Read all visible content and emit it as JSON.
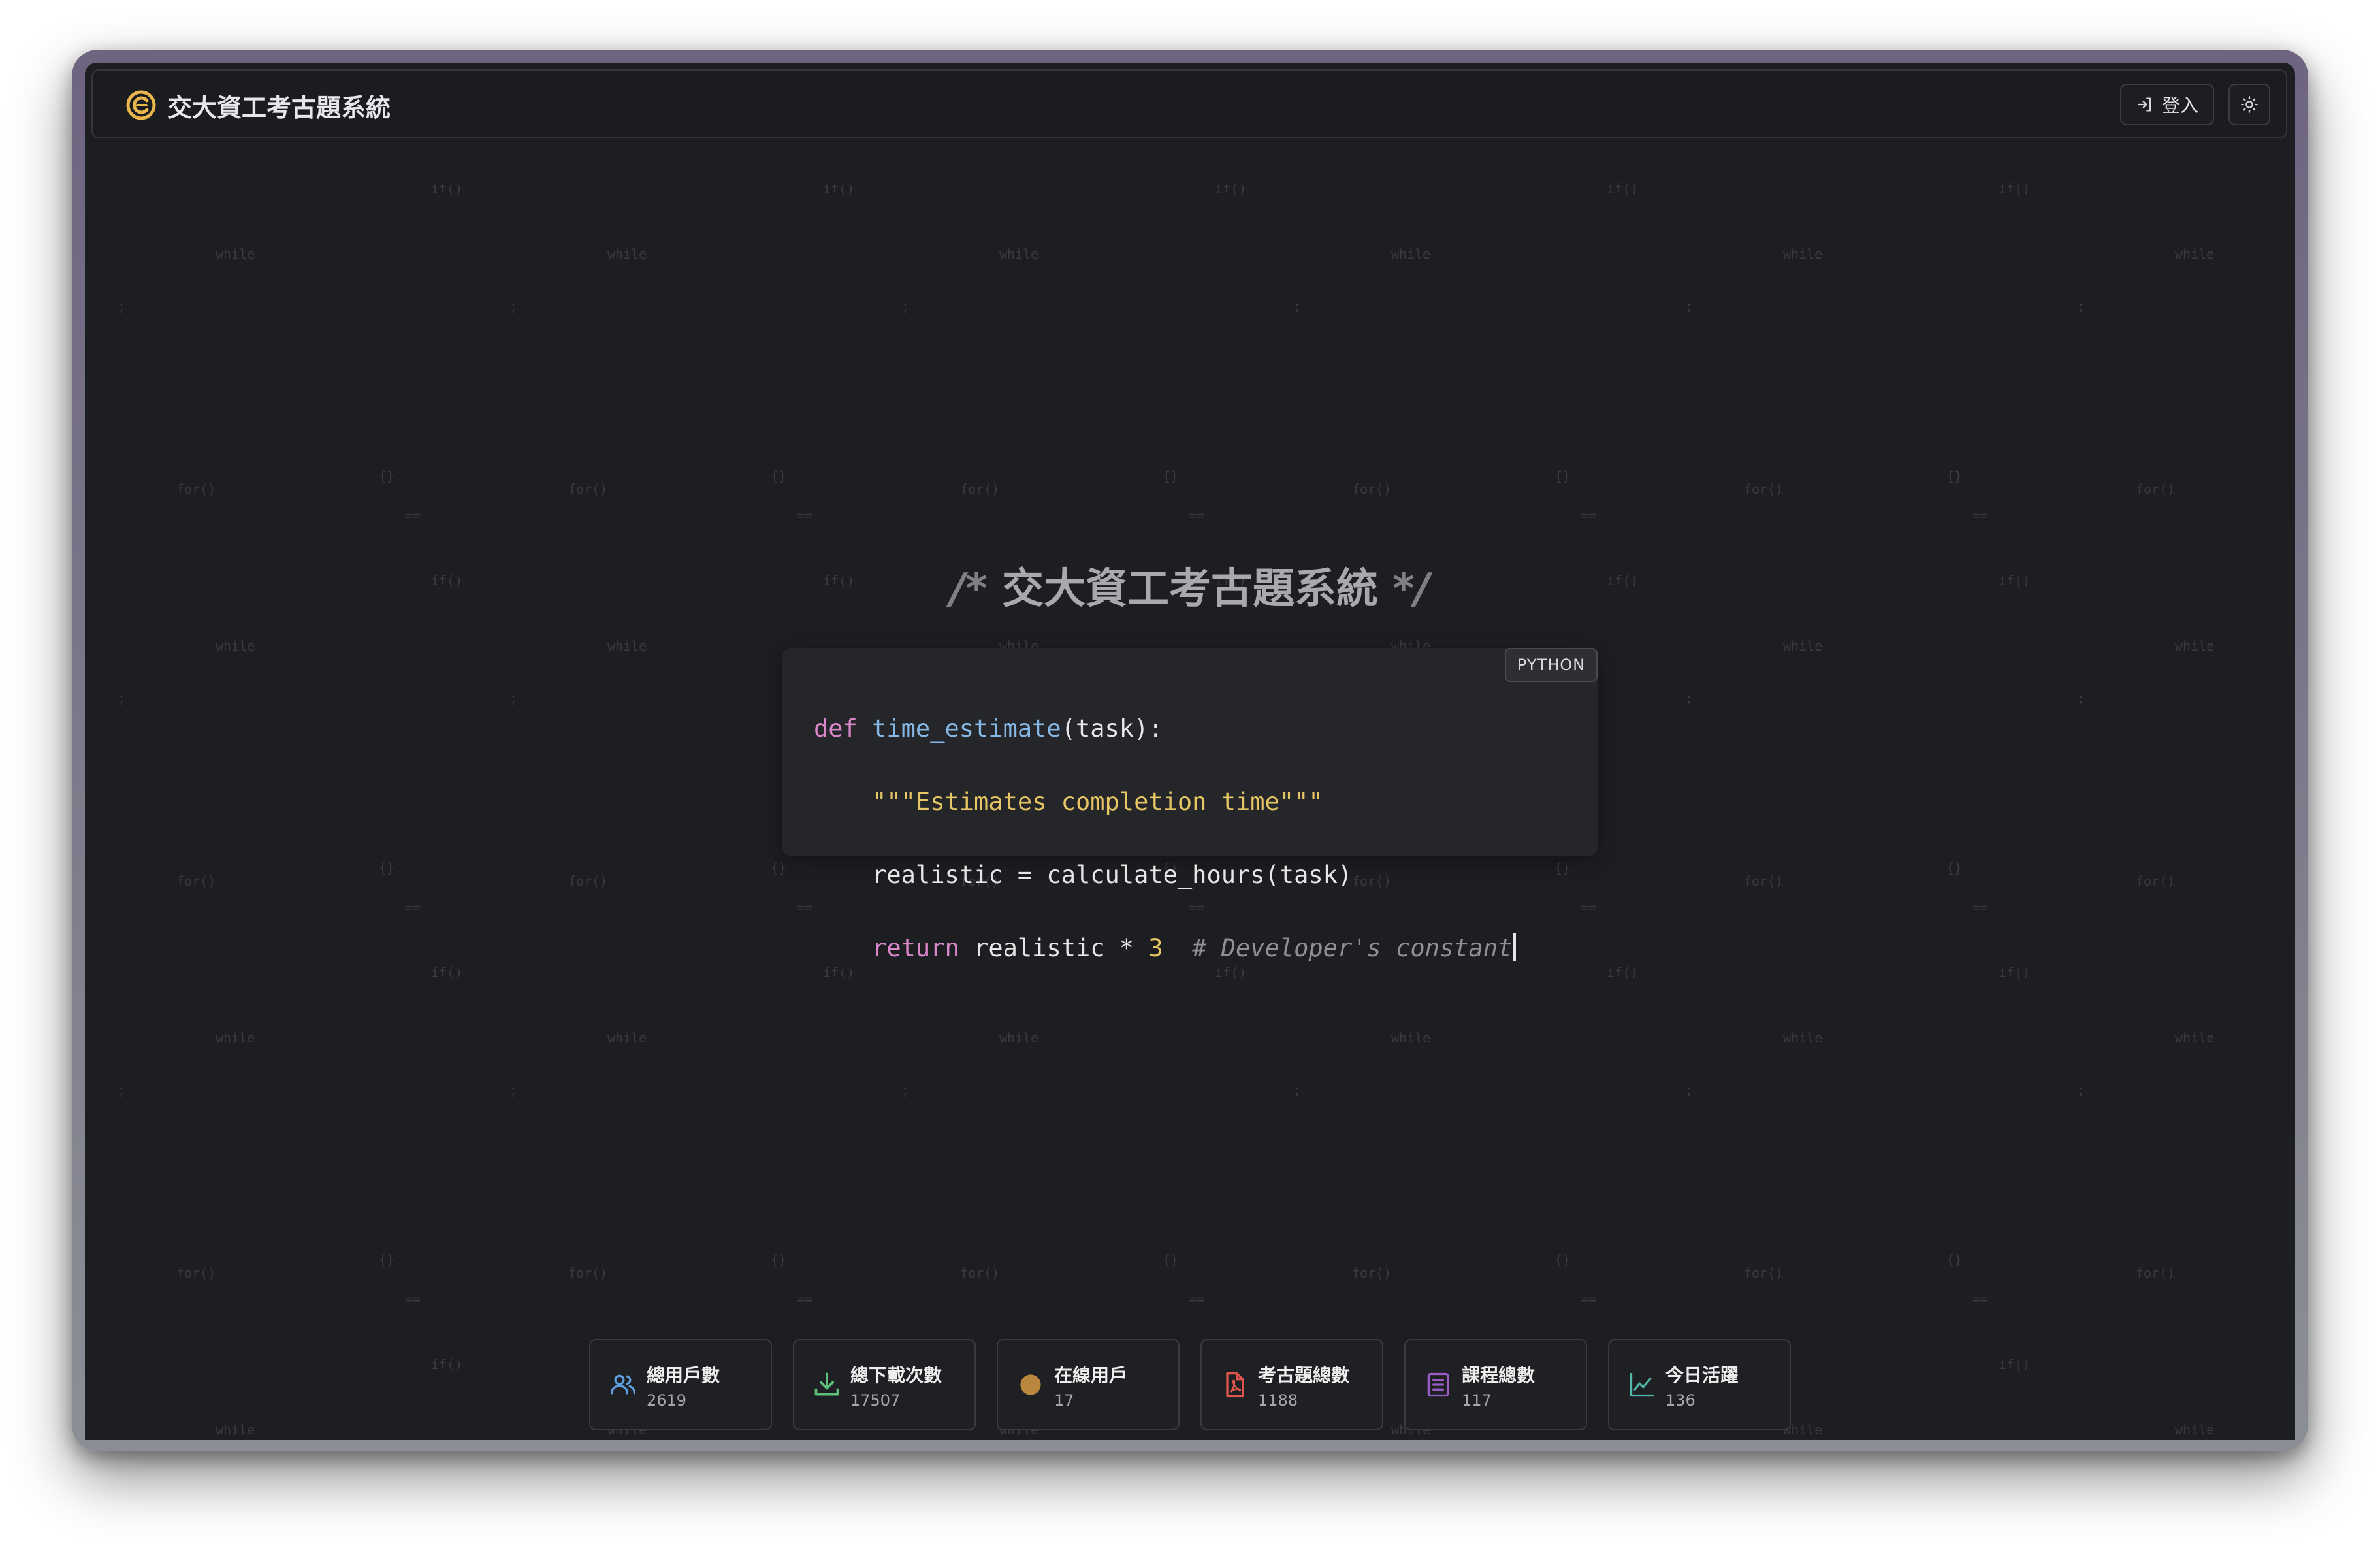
{
  "app": {
    "title": "交大資工考古題系統",
    "login_label": "登入"
  },
  "hero": {
    "comment_open": "/*",
    "title": "交大資工考古題系統",
    "comment_close": "*/"
  },
  "code_card": {
    "language": "PYTHON",
    "lines": {
      "l1_kw": "def",
      "l1_fn": "time_estimate",
      "l1_rest": "(task):",
      "l2_str": "\"\"\"Estimates completion time\"\"\"",
      "l3": "realistic = calculate_hours(task)",
      "l4_kw": "return",
      "l4_mid": " realistic * ",
      "l4_num": "3",
      "l4_cmt": "# Developer's constant"
    }
  },
  "background_tokens": [
    "for()",
    "==",
    "if()",
    "while",
    ";",
    "{}"
  ],
  "stats": [
    {
      "label": "總用戶數",
      "value": "2619",
      "icon": "users-icon",
      "color": "#5f9fe0"
    },
    {
      "label": "總下載次數",
      "value": "17507",
      "icon": "download-icon",
      "color": "#5fc07a"
    },
    {
      "label": "在線用戶",
      "value": "17",
      "icon": "online-dot-icon",
      "color": "#b9863e"
    },
    {
      "label": "考古題總數",
      "value": "1188",
      "icon": "pdf-file-icon",
      "color": "#e0564f"
    },
    {
      "label": "課程總數",
      "value": "117",
      "icon": "course-list-icon",
      "color": "#9a5cc9"
    },
    {
      "label": "今日活躍",
      "value": "136",
      "icon": "trending-chart-icon",
      "color": "#4fb8a8"
    }
  ],
  "colors": {
    "background": "#1d1e21",
    "accent_logo": "#e8b64a"
  }
}
